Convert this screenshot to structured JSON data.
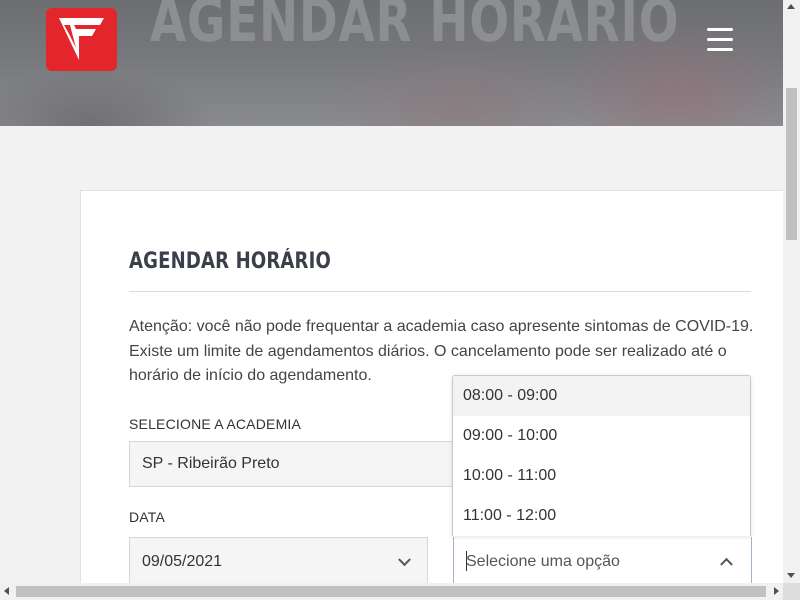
{
  "header": {
    "title": "AGENDAR HORÁRIO",
    "brand_color": "#e3262b",
    "logo_icon": "flash-f-logo",
    "menu_icon": "hamburger-menu-icon"
  },
  "card": {
    "title": "AGENDAR HORÁRIO",
    "notice_lines": [
      "Atenção: você não pode frequentar a academia caso apresente sintomas de COVID-19.",
      "Existe um limite de agendamentos diários. O cancelamento pode ser realizado até o",
      "horário de início do agendamento."
    ],
    "academy_label": "SELECIONE A ACADEMIA",
    "academy_value": "SP - Ribeirão Preto",
    "date_label": "DATA",
    "date_value": "09/05/2021",
    "time_placeholder": "Selecione uma opção"
  },
  "dropdown": {
    "options": [
      "08:00 - 09:00",
      "09:00 - 10:00",
      "10:00 - 11:00",
      "11:00 - 12:00"
    ],
    "highlighted_index": 0
  }
}
